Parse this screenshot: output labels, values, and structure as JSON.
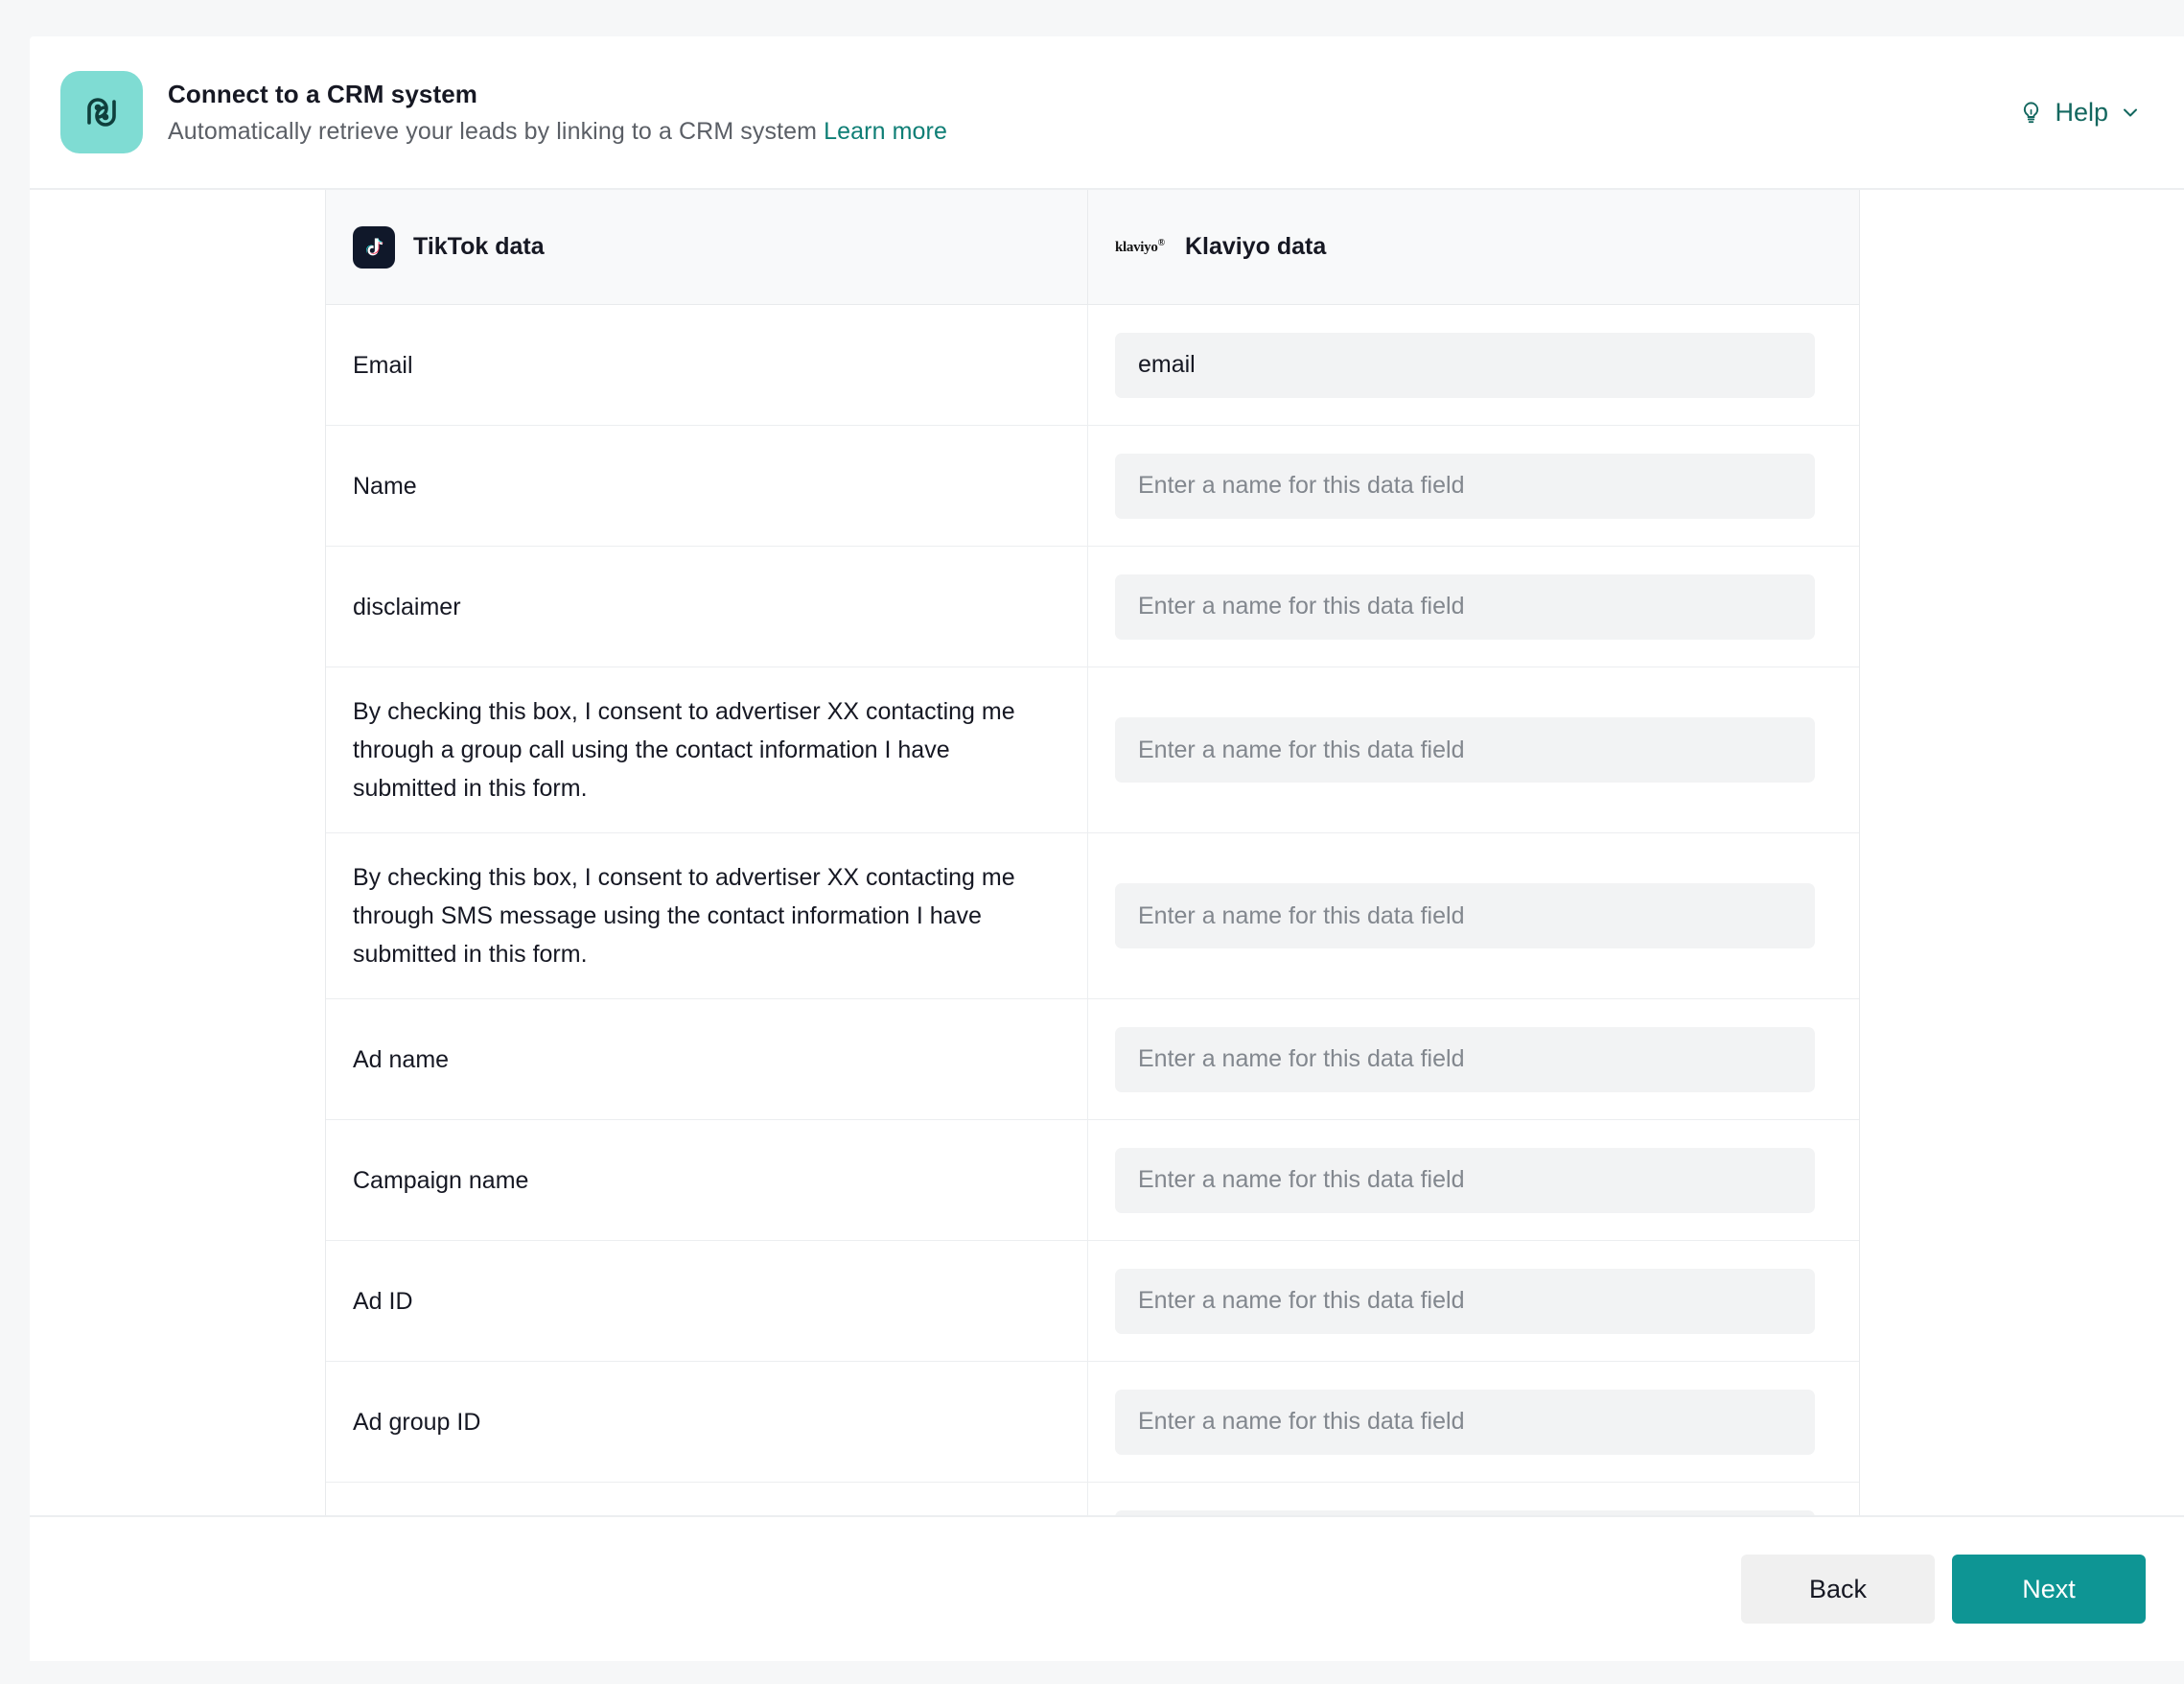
{
  "header": {
    "title": "Connect to a CRM system",
    "subtitle": "Automatically retrieve your leads by linking to a CRM system",
    "learn_more": "Learn more",
    "help_label": "Help",
    "icon_bg": "#7fdcd3",
    "accent_color": "#0e9594",
    "link_color": "#0e7e75"
  },
  "table": {
    "columns": [
      {
        "label": "TikTok data",
        "icon": "tiktok-icon"
      },
      {
        "label": "Klaviyo data",
        "icon": "klaviyo-logo"
      }
    ],
    "placeholder": "Enter a name for this data field",
    "rows": [
      {
        "source": "Email",
        "value": "email"
      },
      {
        "source": "Name",
        "value": ""
      },
      {
        "source": "disclaimer",
        "value": ""
      },
      {
        "source": "By checking this box, I consent to advertiser XX contacting me through a group call using the contact information I have submitted in this form.",
        "value": ""
      },
      {
        "source": "By checking this box, I consent to advertiser XX contacting me through SMS message using the contact information I have submitted in this form.",
        "value": ""
      },
      {
        "source": "Ad name",
        "value": ""
      },
      {
        "source": "Campaign name",
        "value": ""
      },
      {
        "source": "Ad ID",
        "value": ""
      },
      {
        "source": "Ad group ID",
        "value": ""
      },
      {
        "source": "",
        "value": ""
      }
    ]
  },
  "footer": {
    "back_label": "Back",
    "next_label": "Next"
  }
}
